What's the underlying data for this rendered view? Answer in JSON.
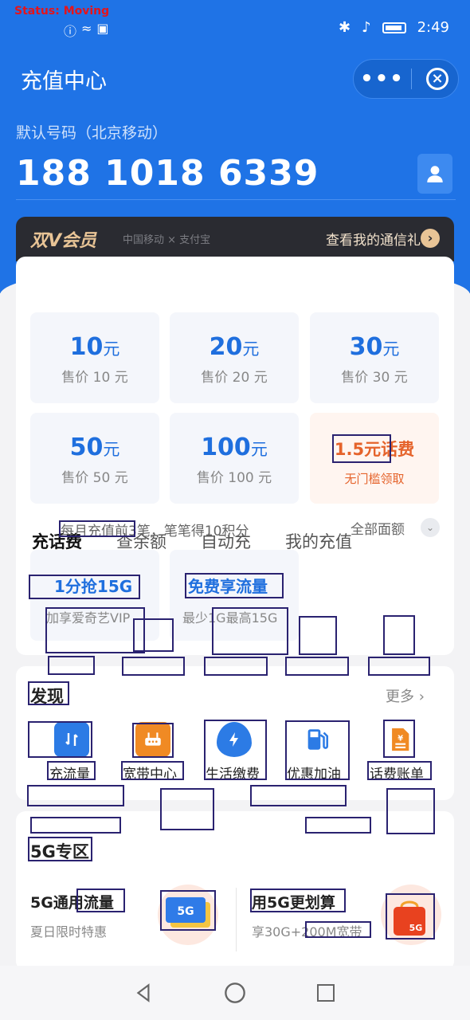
{
  "status_bar": {
    "debug_text": "Status: Moving",
    "time": "2:49"
  },
  "header": {
    "title": "充值中心",
    "capsule_more": "•••",
    "default_label": "默认号码（北京移动）",
    "phone_number": "188 1018 6339"
  },
  "vip": {
    "logo": "双V会员",
    "partners": "中国移动 × 支付宝",
    "link": "查看我的通信礼"
  },
  "tabs": [
    "充话费",
    "查余额",
    "自动充",
    "我的充值"
  ],
  "recharge_tiles": [
    {
      "amount": "10",
      "unit": "元",
      "price": "售价 10 元"
    },
    {
      "amount": "20",
      "unit": "元",
      "price": "售价 20 元"
    },
    {
      "amount": "30",
      "unit": "元",
      "price": "售价 30 元"
    },
    {
      "amount": "50",
      "unit": "元",
      "price": "售价 50 元"
    },
    {
      "amount": "100",
      "unit": "元",
      "price": "售价 100 元"
    }
  ],
  "promo_tile": {
    "title": "1.5元话费",
    "subtitle": "无门槛领取"
  },
  "monthly_note": "每月充值前3笔，笔笔得10积分",
  "all_amounts": "全部面额",
  "flow_tiles": [
    {
      "title": "1分抢15G",
      "subtitle": "加享爱奇艺VIP"
    },
    {
      "title": "免费享流量",
      "subtitle": "最少1G最高15G"
    }
  ],
  "discover": {
    "title": "发现",
    "more": "更多",
    "items": [
      {
        "label": "充流量",
        "icon": "data-transfer-icon",
        "color": "#2c7be5"
      },
      {
        "label": "宽带中心",
        "icon": "router-icon",
        "color": "#f08a24"
      },
      {
        "label": "生活缴费",
        "icon": "bolt-icon",
        "color": "#2c7be5"
      },
      {
        "label": "优惠加油",
        "icon": "fuel-pump-icon",
        "color": "#2c7be5"
      },
      {
        "label": "话费账单",
        "icon": "bill-icon",
        "color": "#f08a24"
      }
    ]
  },
  "zone_5g": {
    "title": "5G专区",
    "items": [
      {
        "title": "5G通用流量",
        "subtitle": "夏日限时特惠",
        "badge": "5G"
      },
      {
        "title": "用5G更划算",
        "subtitle": "享30G+200M宽带",
        "badge": "5G"
      }
    ]
  },
  "colors": {
    "primary": "#1f73e6",
    "accent_orange": "#e5632b",
    "vip_gold": "#e8c496",
    "annotation_box": "#2a2270"
  }
}
